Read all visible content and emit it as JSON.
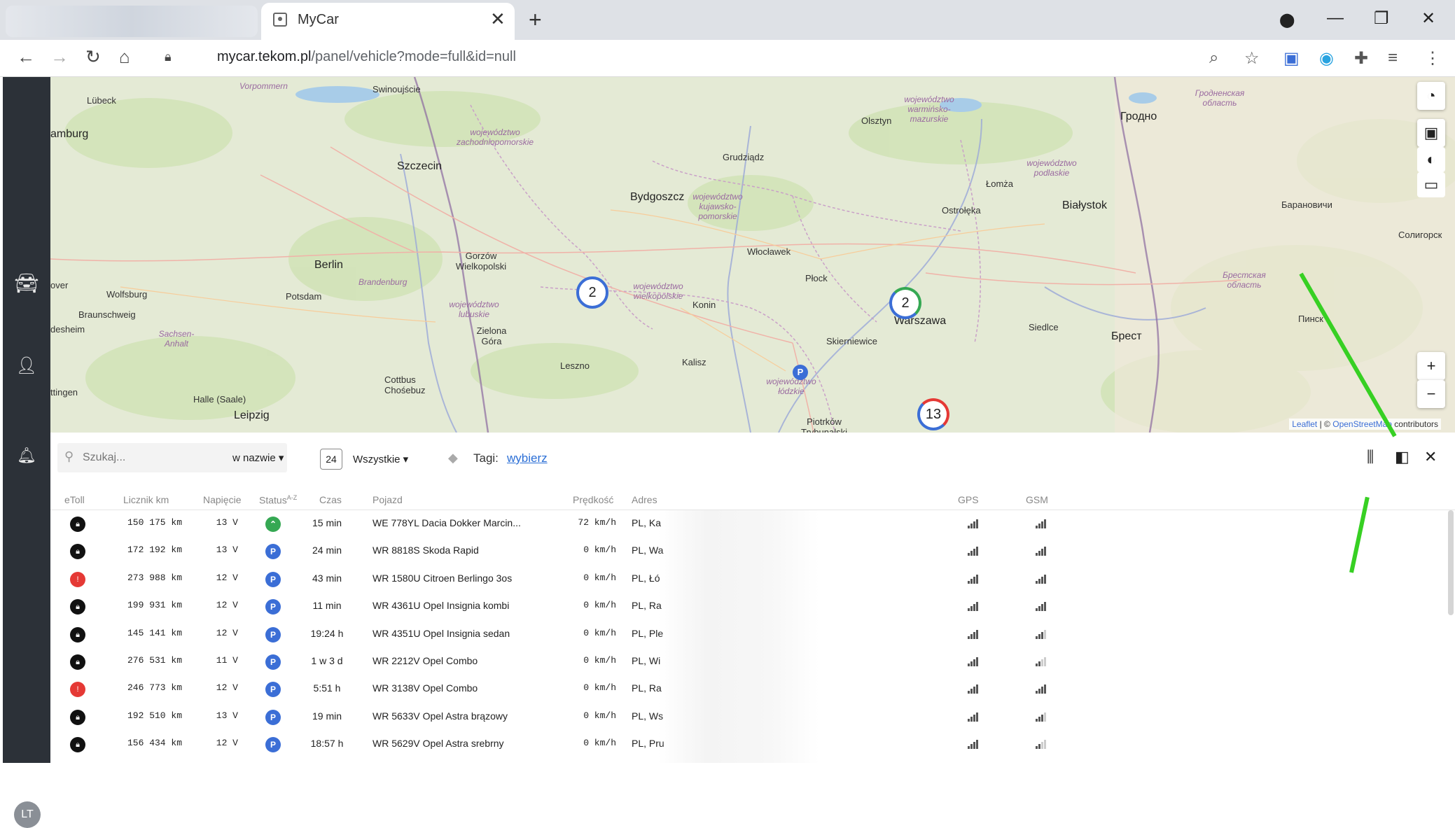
{
  "browser": {
    "tab_title": "MyCar",
    "url_host": "mycar.tekom.pl",
    "url_path": "/panel/vehicle?mode=full&id=null"
  },
  "sidebar": {
    "avatar_initials": "LT"
  },
  "map": {
    "labels": [
      "Lübeck",
      "amburg",
      "Szczecin",
      "Bydgoszcz",
      "Grudziądz",
      "Olsztyn",
      "Гродно",
      "Białystok",
      "Łomża",
      "Ostrołęka",
      "Włocławek",
      "Płock",
      "Konin",
      "Gorzów Wielkopolski",
      "Berlin",
      "Potsdam",
      "Wolfsburg",
      "Braunschweig",
      "Zielona Góra",
      "Leszno",
      "Kalisz",
      "Skierniewice",
      "Siedlce",
      "Брест",
      "Cottbus Chośebuz",
      "Halle (Saale)",
      "Leipzig",
      "Piotrków Trybunalski",
      "Warszawa",
      "Барановичи",
      "Солигорск",
      "Пинск",
      "over",
      "desheim",
      "ttingen",
      "Swinoujście",
      "Vorpommern"
    ],
    "regions": [
      "województwo zachodniopomorskie",
      "województwo warmińsko-mazurskie",
      "województwo kujawsko-pomorskie",
      "województwo podlaskie",
      "województwo wielkopolskie",
      "województwo lubuskie",
      "województwo łódzkie",
      "Brandenburg",
      "Sachsen-Anhalt",
      "Брестская область",
      "Гродненская область"
    ],
    "clusters": [
      "2",
      "2",
      "13"
    ],
    "attribution_leaflet": "Leaflet",
    "attribution_osm": "OpenStreetMap",
    "attribution_suffix": "contributors"
  },
  "toolbar": {
    "search_placeholder": "Szukaj...",
    "search_scope": "w nazwie",
    "count": "24",
    "filter": "Wszystkie",
    "tags_label": "Tagi:",
    "tags_link": "wybierz"
  },
  "table": {
    "headers": {
      "etoll": "eToll",
      "km": "Licznik km",
      "voltage": "Napięcie",
      "status": "Status",
      "status_sort": "A-Z",
      "time": "Czas",
      "vehicle": "Pojazd",
      "speed": "Prędkość",
      "address": "Adres",
      "gps": "GPS",
      "gsm": "GSM"
    },
    "rows": [
      {
        "etoll": "black",
        "km": "150 175 km",
        "volt": "13 V",
        "status": "green",
        "time": "15 min",
        "vehicle": "WE 778YL Dacia Dokker Marcin...",
        "speed": "72 km/h",
        "addr": "PL, Ka",
        "gsm": 4
      },
      {
        "etoll": "black",
        "km": "172 192 km",
        "volt": "13 V",
        "status": "P",
        "time": "24 min",
        "vehicle": "WR 8818S Skoda Rapid",
        "speed": "0 km/h",
        "addr": "PL, Wa",
        "gsm": 4
      },
      {
        "etoll": "red",
        "km": "273 988 km",
        "volt": "12 V",
        "status": "P",
        "time": "43 min",
        "vehicle": "WR 1580U Citroen Berlingo 3os",
        "speed": "0 km/h",
        "addr": "PL, Łó",
        "gsm": 4
      },
      {
        "etoll": "black",
        "km": "199 931 km",
        "volt": "12 V",
        "status": "P",
        "time": "11 min",
        "vehicle": "WR 4361U Opel Insignia kombi",
        "speed": "0 km/h",
        "addr": "PL, Ra",
        "gsm": 4
      },
      {
        "etoll": "black",
        "km": "145 141 km",
        "volt": "12 V",
        "status": "P",
        "time": "19:24 h",
        "vehicle": "WR 4351U Opel Insignia sedan",
        "speed": "0 km/h",
        "addr": "PL, Ple",
        "gsm": 3
      },
      {
        "etoll": "black",
        "km": "276 531 km",
        "volt": "11 V",
        "status": "P",
        "time": "1 w 3 d",
        "vehicle": "WR 2212V Opel Combo",
        "speed": "0 km/h",
        "addr": "PL, Wi",
        "gsm": 2
      },
      {
        "etoll": "red",
        "km": "246 773 km",
        "volt": "12 V",
        "status": "P",
        "time": "5:51 h",
        "vehicle": "WR 3138V Opel Combo",
        "speed": "0 km/h",
        "addr": "PL, Ra",
        "gsm": 4
      },
      {
        "etoll": "black",
        "km": "192 510 km",
        "volt": "13 V",
        "status": "P",
        "time": "19 min",
        "vehicle": "WR 5633V Opel Astra brązowy",
        "speed": "0 km/h",
        "addr": "PL, Ws",
        "gsm": 3
      },
      {
        "etoll": "black",
        "km": "156 434 km",
        "volt": "12 V",
        "status": "P",
        "time": "18:57 h",
        "vehicle": "WR 5629V Opel Astra srebrny",
        "speed": "0 km/h",
        "addr": "PL, Pru",
        "gsm": 2
      }
    ]
  },
  "icons": {
    "etoll": "lock-icon",
    "status_parked": "P",
    "status_moving": "arrow-up-icon"
  },
  "colors": {
    "accent": "#3b6ed6",
    "sidebar": "#2c3138",
    "moving": "#35a853",
    "alert": "#e53935",
    "arrow": "#37d023"
  }
}
